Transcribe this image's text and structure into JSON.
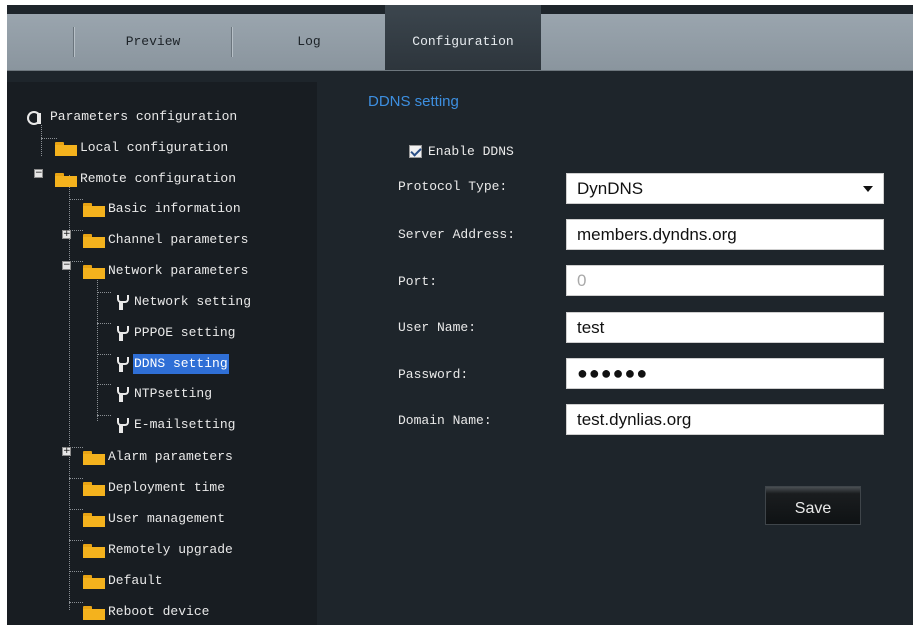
{
  "tabs": [
    {
      "label": "Preview"
    },
    {
      "label": "Log"
    },
    {
      "label": "Configuration"
    }
  ],
  "tree": {
    "root": "Parameters configuration",
    "items": {
      "local": "Local configuration",
      "remote": "Remote configuration",
      "basic": "Basic information",
      "channel": "Channel parameters",
      "network": "Network parameters",
      "network_setting": "Network setting",
      "pppoe": "PPPOE setting",
      "ddns": "DDNS setting",
      "ntp": "NTPsetting",
      "email": "E-mailsetting",
      "alarm": "Alarm parameters",
      "deployment": "Deployment time",
      "user_mgmt": "User management",
      "upgrade": "Remotely upgrade",
      "default": "Default",
      "reboot": "Reboot device"
    }
  },
  "form": {
    "title": "DDNS setting",
    "enable_label": "Enable DDNS",
    "enable_checked": true,
    "protocol_label": "Protocol Type:",
    "protocol_value": "DynDNS",
    "server_label": "Server Address:",
    "server_value": "members.dyndns.org",
    "port_label": "Port:",
    "port_value": "0",
    "user_label": "User Name:",
    "user_value": "test",
    "password_label": "Password:",
    "password_value": "●●●●●●",
    "domain_label": "Domain Name:",
    "domain_value": "test.dynlias.org",
    "save_label": "Save"
  },
  "colors": {
    "accent": "#3d8fe0",
    "selected": "#2f6fd6",
    "folder": "#f4b21d"
  }
}
